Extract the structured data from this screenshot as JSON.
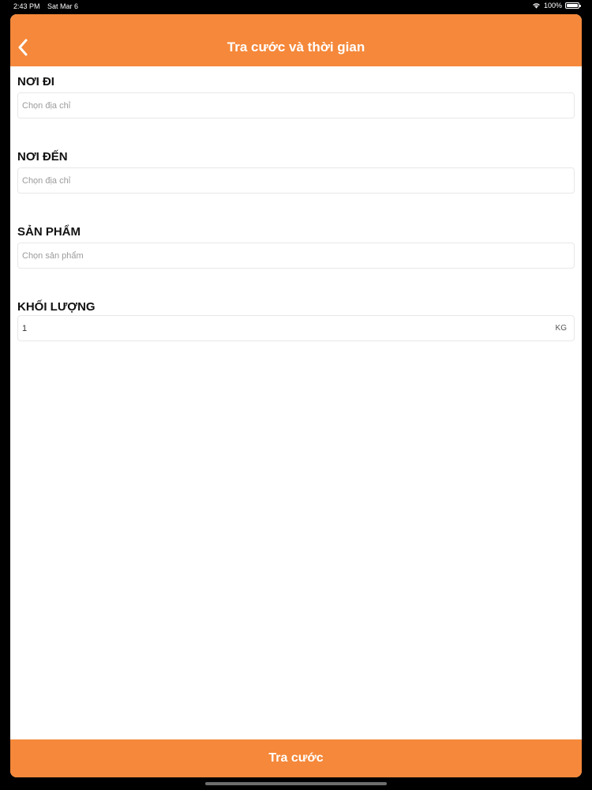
{
  "status_bar": {
    "time": "2:43 PM",
    "date": "Sat Mar 6",
    "battery": "100%",
    "battery_level": 1.0
  },
  "header": {
    "title": "Tra cước và thời gian",
    "back_icon": "chevron-left-icon"
  },
  "form": {
    "origin": {
      "label": "NƠI ĐI",
      "placeholder": "Chọn địa chỉ",
      "value": ""
    },
    "destination": {
      "label": "NƠI ĐẾN",
      "placeholder": "Chọn địa chỉ",
      "value": ""
    },
    "product": {
      "label": "SẢN PHẨM",
      "placeholder": "Chọn sản phẩm",
      "value": ""
    },
    "weight": {
      "label": "KHỐI LƯỢNG",
      "value": "1",
      "unit": "KG"
    }
  },
  "submit_label": "Tra cước",
  "colors": {
    "accent": "#f5883a",
    "background": "#ffffff"
  }
}
